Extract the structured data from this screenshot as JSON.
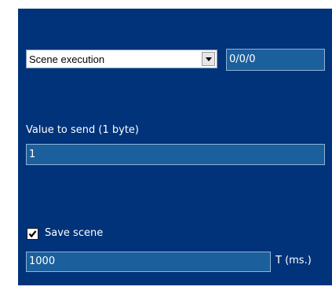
{
  "scene": {
    "type_select": {
      "selected": "Scene execution"
    },
    "group_address": "0/0/0",
    "value_label": "Value to send (1 byte)",
    "value": "1",
    "save_scene": {
      "label": "Save scene",
      "checked": true
    },
    "time_value": "1000",
    "time_unit": "T (ms.)"
  },
  "colors": {
    "panel_background": "#00337a",
    "field_background": "#1b5f9c"
  },
  "icons": {
    "dropdown": "chevron-down-icon",
    "checkbox": "checkmark-icon"
  }
}
